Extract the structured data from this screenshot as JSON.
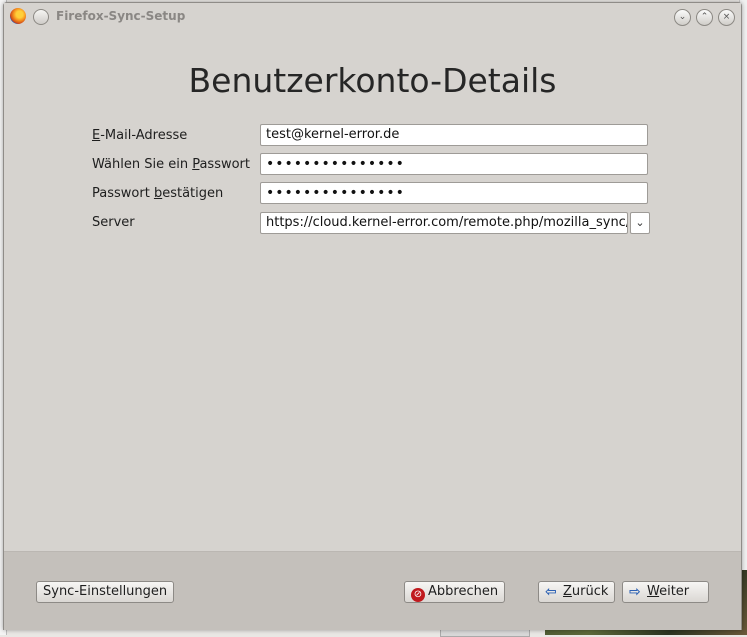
{
  "window": {
    "title": "Firefox-Sync-Setup"
  },
  "heading": "Benutzerkonto-Details",
  "form": {
    "email": {
      "label_prefix": "E",
      "label_rest": "-Mail-Adresse",
      "value": "test@kernel-error.de"
    },
    "password": {
      "label_before": "Wählen Sie ein ",
      "label_key": "P",
      "label_after": "asswort",
      "value": "•••••••••••••••"
    },
    "confirm": {
      "label_before": "Passwort ",
      "label_key": "b",
      "label_after": "estätigen",
      "value": "•••••••••••••••"
    },
    "server": {
      "label": "Server",
      "value": "https://cloud.kernel-error.com/remote.php/mozilla_sync/"
    }
  },
  "footer": {
    "sync_settings": "Sync-Einstellungen",
    "cancel": "Abbrechen",
    "back_key": "Z",
    "back_rest": "urück",
    "next_key": "W",
    "next_rest": "eiter"
  }
}
